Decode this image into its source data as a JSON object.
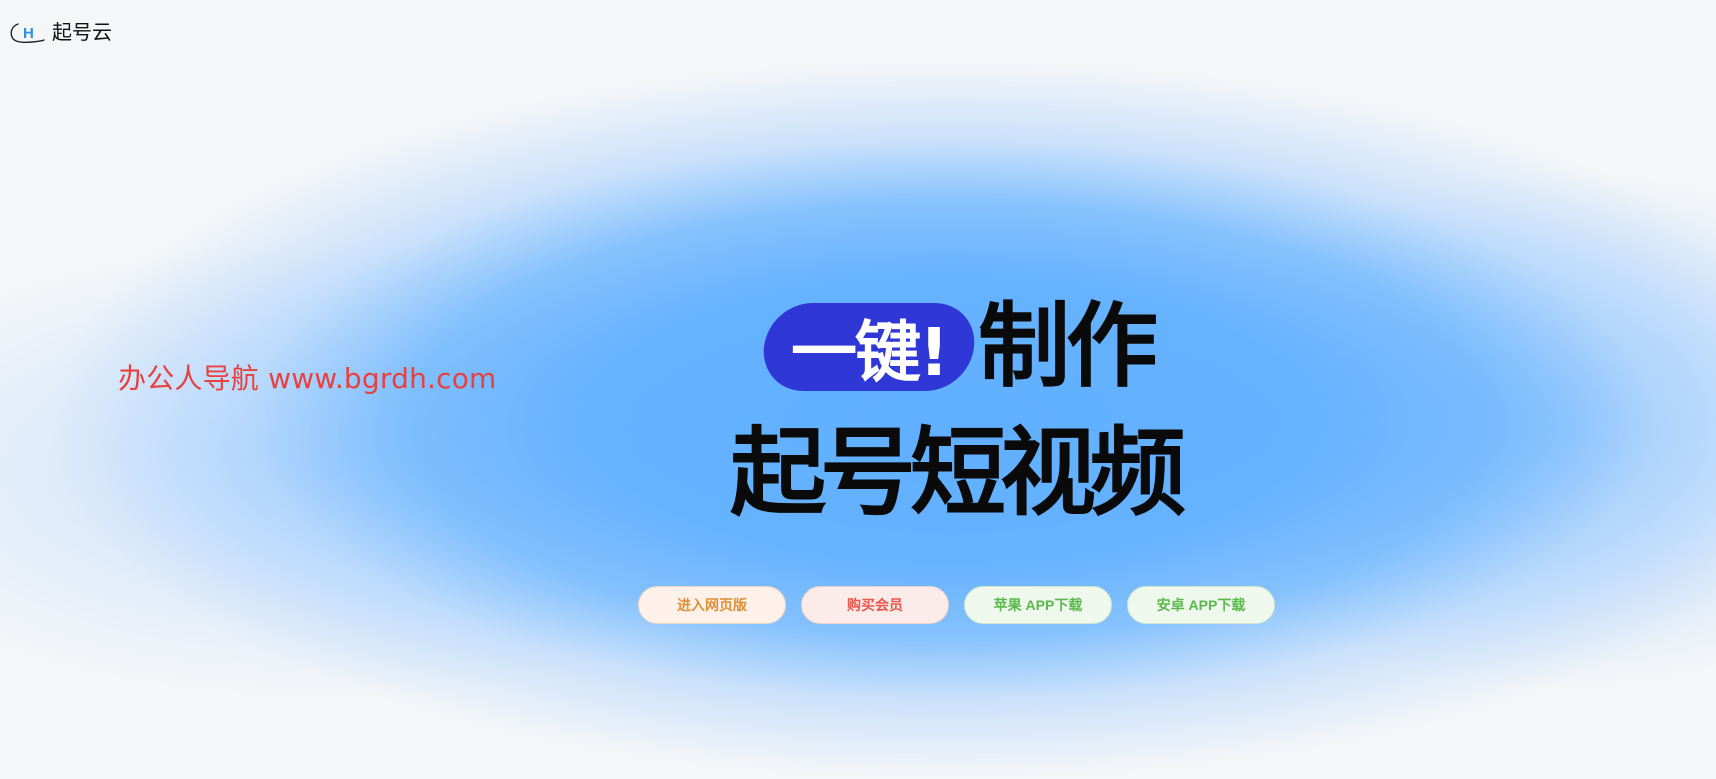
{
  "header": {
    "logo_letter": "H",
    "brand_name": "起号云",
    "logo_icon": "cloud-h-logo-icon"
  },
  "watermark": {
    "text": "办公人导航 www.bgrdh.com",
    "color": "#e8413f"
  },
  "hero": {
    "pill_text": "一键!",
    "line1_text": "制作",
    "line2_text": "起号短视频",
    "pill_color": "#2f38d6"
  },
  "actions": {
    "web_label": "进入网页版",
    "vip_label": "购买会员",
    "ios_label": "苹果 APP下载",
    "android_label": "安卓 APP下载"
  },
  "colors": {
    "accent_blue": "#60b0ff",
    "background": "#f5f6f8"
  }
}
